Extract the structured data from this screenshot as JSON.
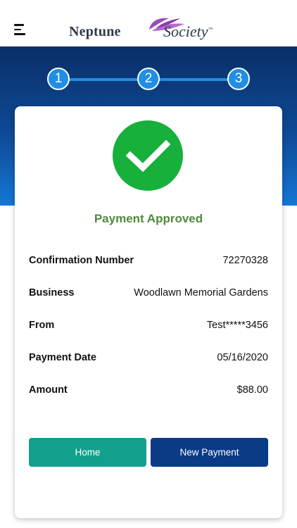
{
  "header": {
    "logo_word1": "Neptune",
    "logo_word2": "Society",
    "logo_tm": "™"
  },
  "stepper": {
    "steps": [
      "1",
      "2",
      "3"
    ],
    "current_step": 3
  },
  "confirmation": {
    "status": "Payment Approved",
    "rows": [
      {
        "label": "Confirmation Number",
        "value": "72270328"
      },
      {
        "label": "Business",
        "value": "Woodlawn Memorial Gardens"
      },
      {
        "label": "From",
        "value": "Test*****3456"
      },
      {
        "label": "Payment Date",
        "value": "05/16/2020"
      },
      {
        "label": "Amount",
        "value": "$88.00"
      }
    ]
  },
  "actions": {
    "home_label": "Home",
    "new_payment_label": "New Payment"
  },
  "colors": {
    "band_top": "#0a2f68",
    "band_bottom": "#1577d6",
    "step_blue": "#1f8ee6",
    "success_green": "#17b03a",
    "status_text_green": "#4f8a3a",
    "home_button": "#12a08c",
    "new_payment_button": "#0b3a86",
    "logo_leaf_purple": "#9b4fb5"
  },
  "icons": {
    "menu": "hamburger-menu-icon",
    "success": "checkmark-icon",
    "logo_leaf": "leaf-icon"
  }
}
